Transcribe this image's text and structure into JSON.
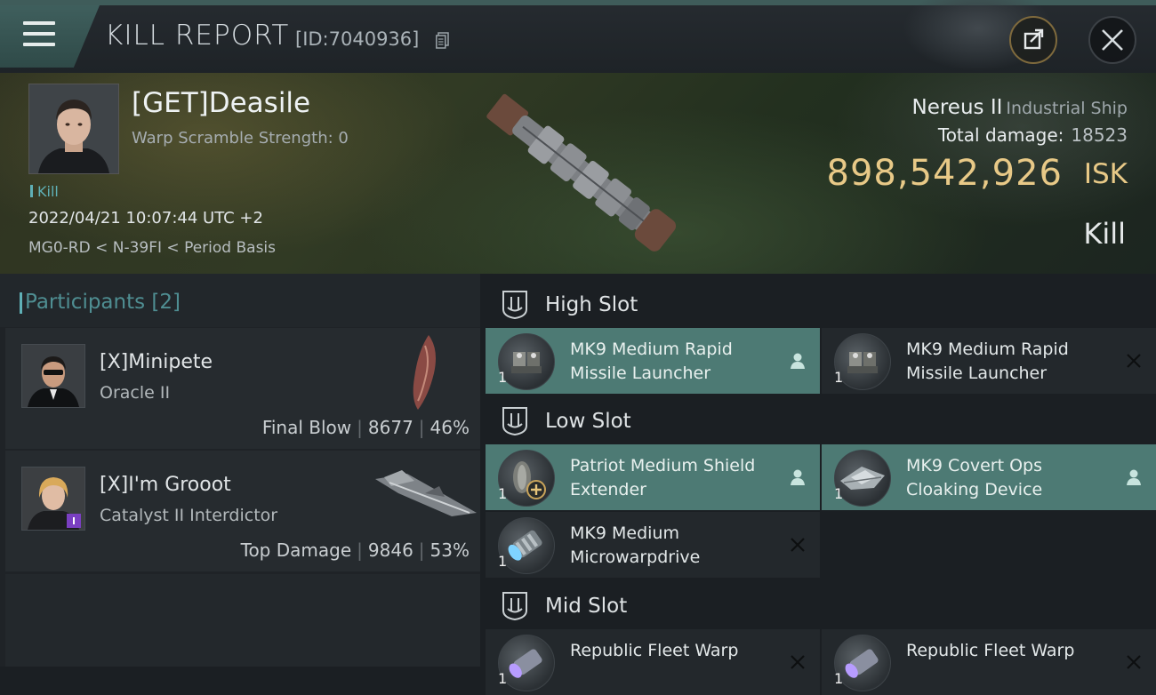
{
  "header": {
    "title": "KILL REPORT",
    "report_id": "[ID:7040936]"
  },
  "victim": {
    "name": "[GET]Deasile",
    "warp_scramble": "Warp Scramble Strength: 0",
    "tag": "Kill",
    "datetime": "2022/04/21 10:07:44 UTC +2",
    "location": "MG0-RD < N-39FI < Period Basis",
    "ship_name": "Nereus II",
    "ship_class": "Industrial Ship",
    "total_damage_label": "Total damage:",
    "total_damage": "18523",
    "isk_value": "898,542,926",
    "isk_unit": "ISK",
    "result": "Kill"
  },
  "participants": {
    "title": "Participants",
    "count": "[2]",
    "items": [
      {
        "name": "[X]Minipete",
        "ship": "Oracle II",
        "role": "Final Blow",
        "damage": "8677",
        "percent": "46%"
      },
      {
        "name": "[X]I'm Grooot",
        "ship": "Catalyst II Interdictor",
        "role": "Top Damage",
        "damage": "9846",
        "percent": "53%"
      }
    ]
  },
  "slots": {
    "high": {
      "label": "High Slot",
      "modules": [
        {
          "qty": "1",
          "name": "MK9 Medium Rapid Missile Launcher",
          "status": "dropped"
        },
        {
          "qty": "1",
          "name": "MK9 Medium Rapid Missile Launcher",
          "status": "destroyed"
        }
      ]
    },
    "low": {
      "label": "Low Slot",
      "modules": [
        {
          "qty": "1",
          "name": "Patriot Medium Shield Extender",
          "status": "dropped"
        },
        {
          "qty": "1",
          "name": "MK9 Covert Ops Cloaking Device",
          "status": "dropped"
        },
        {
          "qty": "1",
          "name": "MK9 Medium Microwarpdrive",
          "status": "destroyed"
        }
      ]
    },
    "mid": {
      "label": "Mid Slot",
      "modules": [
        {
          "qty": "1",
          "name": "Republic Fleet Warp",
          "status": "destroyed"
        },
        {
          "qty": "1",
          "name": "Republic Fleet Warp",
          "status": "destroyed"
        }
      ]
    }
  },
  "colors": {
    "accent_teal": "#5fb0b6",
    "isk_gold": "#e8c987",
    "dropped_row": "#4d7a74"
  },
  "icons": {
    "menu": "hamburger-icon",
    "copy": "copy-icon",
    "share": "share-icon",
    "close": "close-icon",
    "slot": "slot-shield-icon",
    "dropped": "person-icon",
    "destroyed": "cross-icon"
  }
}
